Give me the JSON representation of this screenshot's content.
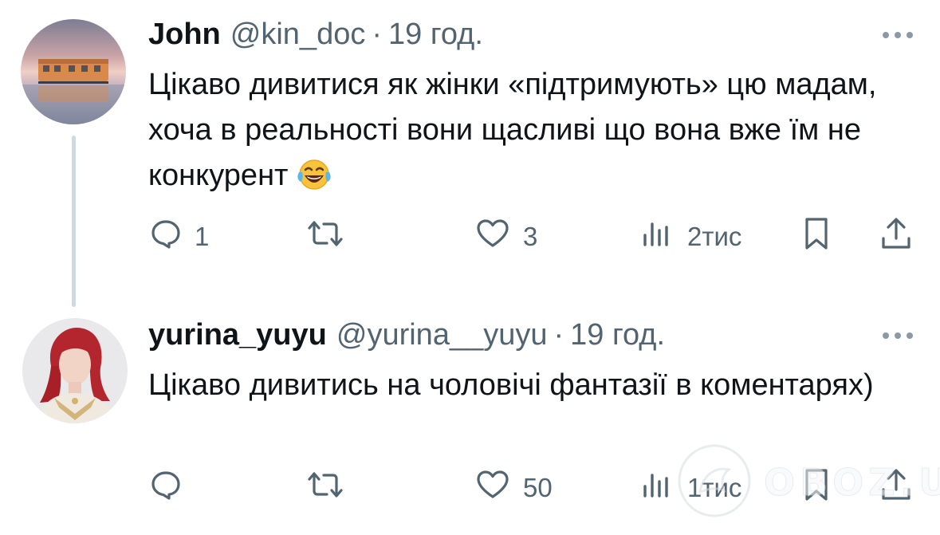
{
  "tweets": [
    {
      "author": {
        "name": "John",
        "handle": "@kin_doc",
        "time": "19 год.",
        "avatar": "train-on-water-photo"
      },
      "text": "Цікаво дивитися як жінки «підтримують» цю мадам, хоча в реальності вони щасливі що вона вже їм не конкурент",
      "emoji": "face-with-tears-of-joy-emoji",
      "actions": {
        "replies": "1",
        "reposts": "",
        "likes": "3",
        "views": "2тис"
      }
    },
    {
      "author": {
        "name": "yurina_yuyu",
        "handle": "@yurina__yuyu",
        "time": "19 год.",
        "avatar": "red-haired-woman-portrait"
      },
      "text": "Цікаво дивитись на чоловічі фантазії в коментарях)",
      "actions": {
        "replies": "",
        "reposts": "",
        "likes": "50",
        "views": "1тис"
      }
    }
  ],
  "separator": "·",
  "watermark": {
    "text": "OBOZ.UA"
  },
  "colors": {
    "text": "#0f1419",
    "secondary": "#536471",
    "thread_line": "#cfd9de",
    "background": "#ffffff"
  }
}
